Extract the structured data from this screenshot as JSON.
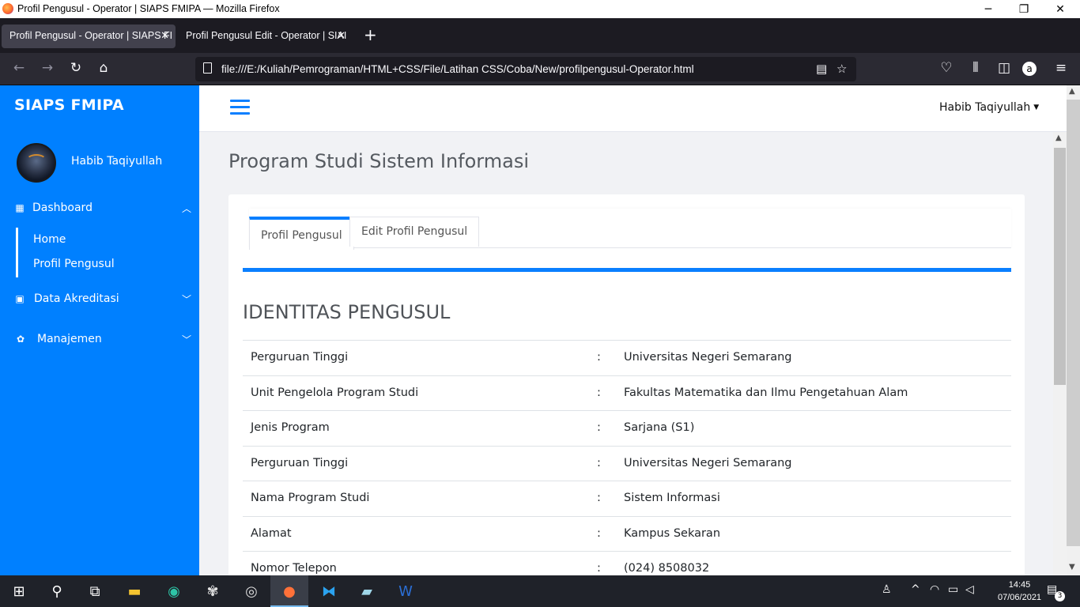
{
  "window": {
    "title": "Profil Pengusul - Operator | SIAPS FMIPA — Mozilla Firefox",
    "controls": {
      "minimize": "─",
      "restore": "❐",
      "close": "✕"
    }
  },
  "browser": {
    "tabs": [
      {
        "label": "Profil Pengusul - Operator | SIAPS FI",
        "close": "✕"
      },
      {
        "label": "Profil Pengusul Edit - Operator | SIAI",
        "close": "✕"
      }
    ],
    "new_tab": "+",
    "url": "file:///E:/Kuliah/Pemrograman/HTML+CSS/File/Latihan CSS/Coba/New/profilpengusul-Operator.html"
  },
  "sidebar": {
    "brand": "SIAPS FMIPA",
    "user": "Habib Taqiyullah",
    "menu": [
      {
        "label": "Dashboard",
        "icon": "grid-icon",
        "chevron": "up"
      },
      {
        "label": "Data Akreditasi",
        "icon": "calendar-icon",
        "chevron": "down"
      },
      {
        "label": "Manajemen",
        "icon": "gear-icon",
        "chevron": "down"
      }
    ],
    "submenu": [
      "Home",
      "Profil Pengusul"
    ]
  },
  "topnav": {
    "user": "Habib Taqiyullah"
  },
  "page": {
    "title": "Program Studi Sistem Informasi",
    "tabs": [
      "Profil Pengusul",
      "Edit Profil Pengusul"
    ],
    "section_title": "IDENTITAS PENGUSUL",
    "rows": [
      {
        "key": "Perguruan Tinggi",
        "sep": ":",
        "value": "Universitas Negeri Semarang"
      },
      {
        "key": "Unit Pengelola Program Studi",
        "sep": ":",
        "value": "Fakultas Matematika dan Ilmu Pengetahuan Alam"
      },
      {
        "key": "Jenis Program",
        "sep": ":",
        "value": "Sarjana (S1)"
      },
      {
        "key": "Perguruan Tinggi",
        "sep": ":",
        "value": "Universitas Negeri Semarang"
      },
      {
        "key": "Nama Program Studi",
        "sep": ":",
        "value": "Sistem Informasi"
      },
      {
        "key": "Alamat",
        "sep": ":",
        "value": "Kampus Sekaran"
      },
      {
        "key": "Nomor Telepon",
        "sep": ":",
        "value": "(024) 8508032"
      }
    ]
  },
  "taskbar": {
    "time": "14:45",
    "date": "07/06/2021",
    "notifications": "3"
  },
  "colors": {
    "accent": "#0080ff",
    "brand_blue": "#0a7fff"
  }
}
